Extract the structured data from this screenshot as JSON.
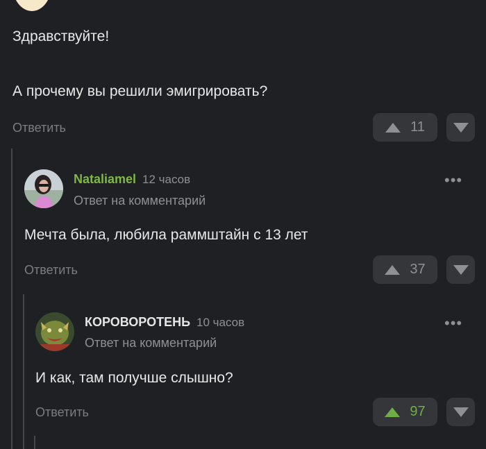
{
  "colors": {
    "background": "#1f2023",
    "username_green": "#7fb848",
    "vote_green": "#6fae47",
    "muted": "#8e9094",
    "pill": "#34363a"
  },
  "comments": [
    {
      "lines": [
        "Здравствуйте!",
        "А прочему вы решили эмигрировать?"
      ],
      "reply_label": "Ответить",
      "votes": "11",
      "voted_up": false
    },
    {
      "username": "Nataliamel",
      "time": "12 часов",
      "subline": "Ответ на комментарий",
      "text": "Мечта была, любила раммштайн с 13 лет",
      "reply_label": "Ответить",
      "votes": "37",
      "voted_up": false,
      "more_label": "•••"
    },
    {
      "username": "КОРОВОРОТЕНЬ",
      "time": "10 часов",
      "subline": "Ответ на комментарий",
      "text": "И как, там получше слышно?",
      "reply_label": "Ответить",
      "votes": "97",
      "voted_up": true,
      "more_label": "•••"
    }
  ],
  "icons": [
    "upvote-icon",
    "downvote-icon",
    "more-options-icon"
  ]
}
